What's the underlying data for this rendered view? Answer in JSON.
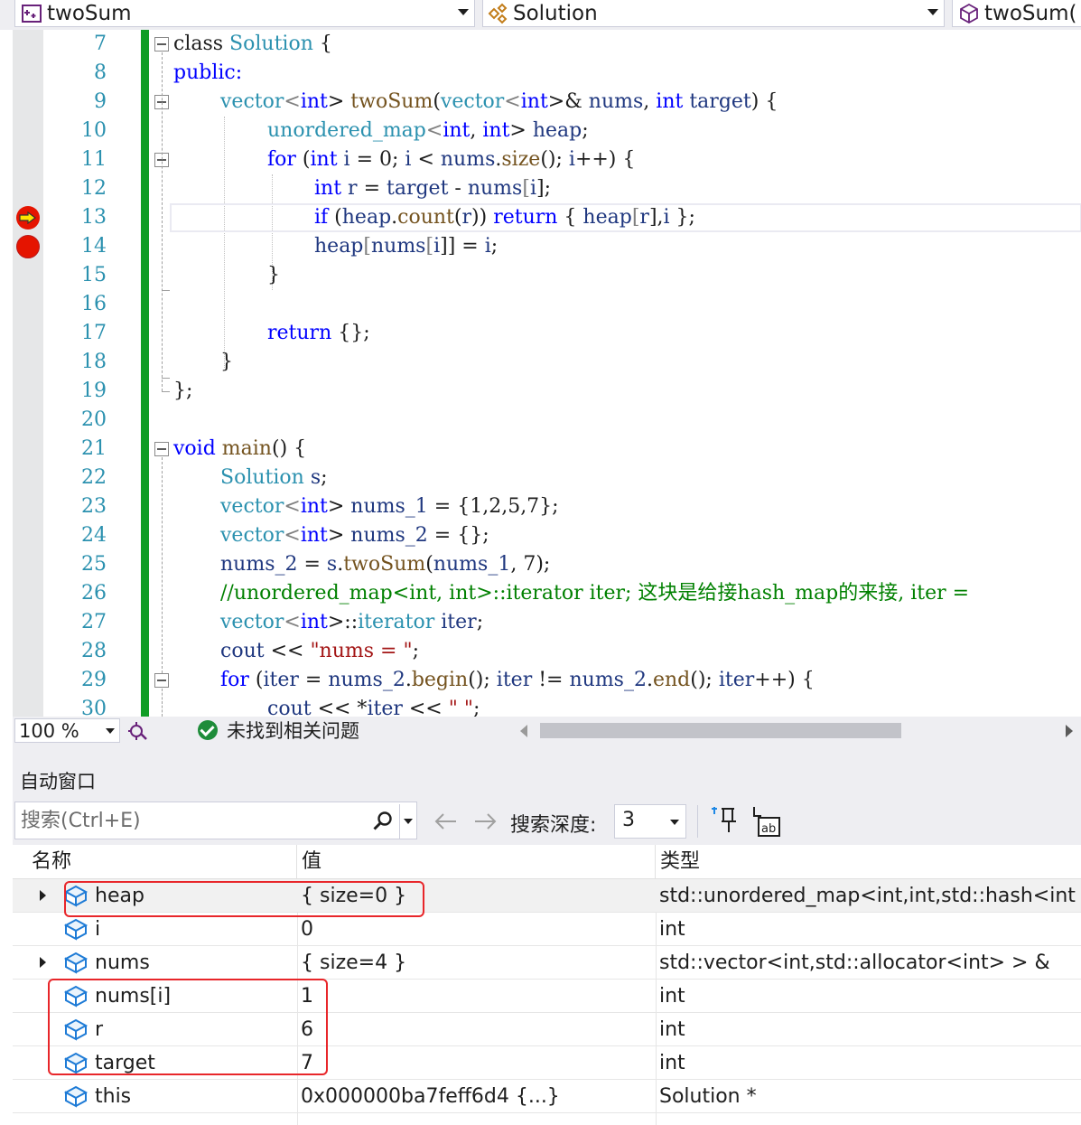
{
  "navbar": {
    "project": "twoSum",
    "class_scope": "Solution",
    "member": "twoSum("
  },
  "editor": {
    "line_numbers": [
      "7",
      "8",
      "9",
      "10",
      "11",
      "12",
      "13",
      "14",
      "15",
      "16",
      "17",
      "18",
      "19",
      "20",
      "21",
      "22",
      "23",
      "24",
      "25",
      "26",
      "27",
      "28",
      "29",
      "30"
    ],
    "current_line": "13",
    "breakpoint_line": "14",
    "colors": {
      "change_bar": "#109d25",
      "keyword": "#0000ff",
      "type": "#2b91af",
      "comment": "#008000",
      "string": "#a31515",
      "breakpoint": "#e51400"
    },
    "code": [
      [
        "class ",
        "Solution",
        " {"
      ],
      [
        "public:"
      ],
      [
        "vector",
        "<",
        "int",
        "> ",
        "twoSum",
        "(",
        "vector",
        "<",
        "int",
        ">& ",
        "nums",
        ", ",
        "int",
        " ",
        "target",
        ") {"
      ],
      [
        "unordered_map",
        "<",
        "int",
        ", ",
        "int",
        "> ",
        "heap",
        ";"
      ],
      [
        "for",
        " (",
        "int",
        " ",
        "i",
        " = 0; ",
        "i",
        " < ",
        "nums",
        ".",
        "size",
        "(); ",
        "i",
        "++) {"
      ],
      [
        "int",
        " ",
        "r",
        " = ",
        "target",
        " - ",
        "nums",
        "[",
        "i",
        "];"
      ],
      [
        "if",
        " (",
        "heap",
        ".",
        "count",
        "(",
        "r",
        ")) ",
        "return",
        " { ",
        "heap",
        "[",
        "r",
        "],",
        "i",
        " };"
      ],
      [
        "heap",
        "[",
        "nums",
        "[",
        "i",
        "]] = ",
        "i",
        ";"
      ],
      [
        "}"
      ],
      [
        ""
      ],
      [
        "return",
        " {};"
      ],
      [
        "}"
      ],
      [
        "};"
      ],
      [
        ""
      ],
      [
        "void",
        " ",
        "main",
        "() {"
      ],
      [
        "Solution",
        " ",
        "s",
        ";"
      ],
      [
        "vector",
        "<",
        "int",
        "> ",
        "nums_1",
        " = {1,2,5,7};"
      ],
      [
        "vector",
        "<",
        "int",
        "> ",
        "nums_2",
        " = {};"
      ],
      [
        "nums_2",
        " = ",
        "s",
        ".",
        "twoSum",
        "(",
        "nums_1",
        ", 7);"
      ],
      [
        "//unordered_map<int, int>::iterator iter; 这块是给接hash_map的来接, iter ="
      ],
      [
        "vector",
        "<",
        "int",
        ">::",
        "iterator",
        " ",
        "iter",
        ";"
      ],
      [
        "cout",
        " << ",
        "\"nums = \"",
        ";"
      ],
      [
        "for",
        " (",
        "iter",
        " = ",
        "nums_2",
        ".",
        "begin",
        "(); ",
        "iter",
        " != ",
        "nums_2",
        ".",
        "end",
        "(); ",
        "iter",
        "++) {"
      ],
      [
        "cout",
        " << *",
        "iter",
        " << ",
        "\" \"",
        ";"
      ]
    ]
  },
  "status": {
    "zoom": "100 %",
    "issues": "未找到相关问题"
  },
  "autos": {
    "title": "自动窗口",
    "search_placeholder": "搜索(Ctrl+E)",
    "depth_label": "搜索深度:",
    "depth_value": "3",
    "columns": {
      "name": "名称",
      "value": "值",
      "type": "类型"
    },
    "rows": [
      {
        "name": "heap",
        "value": "{ size=0 }",
        "type": "std::unordered_map<int,int,std::hash<int",
        "expandable": true
      },
      {
        "name": "i",
        "value": "0",
        "type": "int",
        "expandable": false
      },
      {
        "name": "nums",
        "value": "{ size=4 }",
        "type": "std::vector<int,std::allocator<int> > &",
        "expandable": true
      },
      {
        "name": "nums[i]",
        "value": "1",
        "type": "int",
        "expandable": false
      },
      {
        "name": "r",
        "value": "6",
        "type": "int",
        "expandable": false
      },
      {
        "name": "target",
        "value": "7",
        "type": "int",
        "expandable": false
      },
      {
        "name": "this",
        "value": "0x000000ba7feff6d4 {...}",
        "type": "Solution *",
        "expandable": false
      }
    ],
    "highlight_color": "#e8262a"
  }
}
